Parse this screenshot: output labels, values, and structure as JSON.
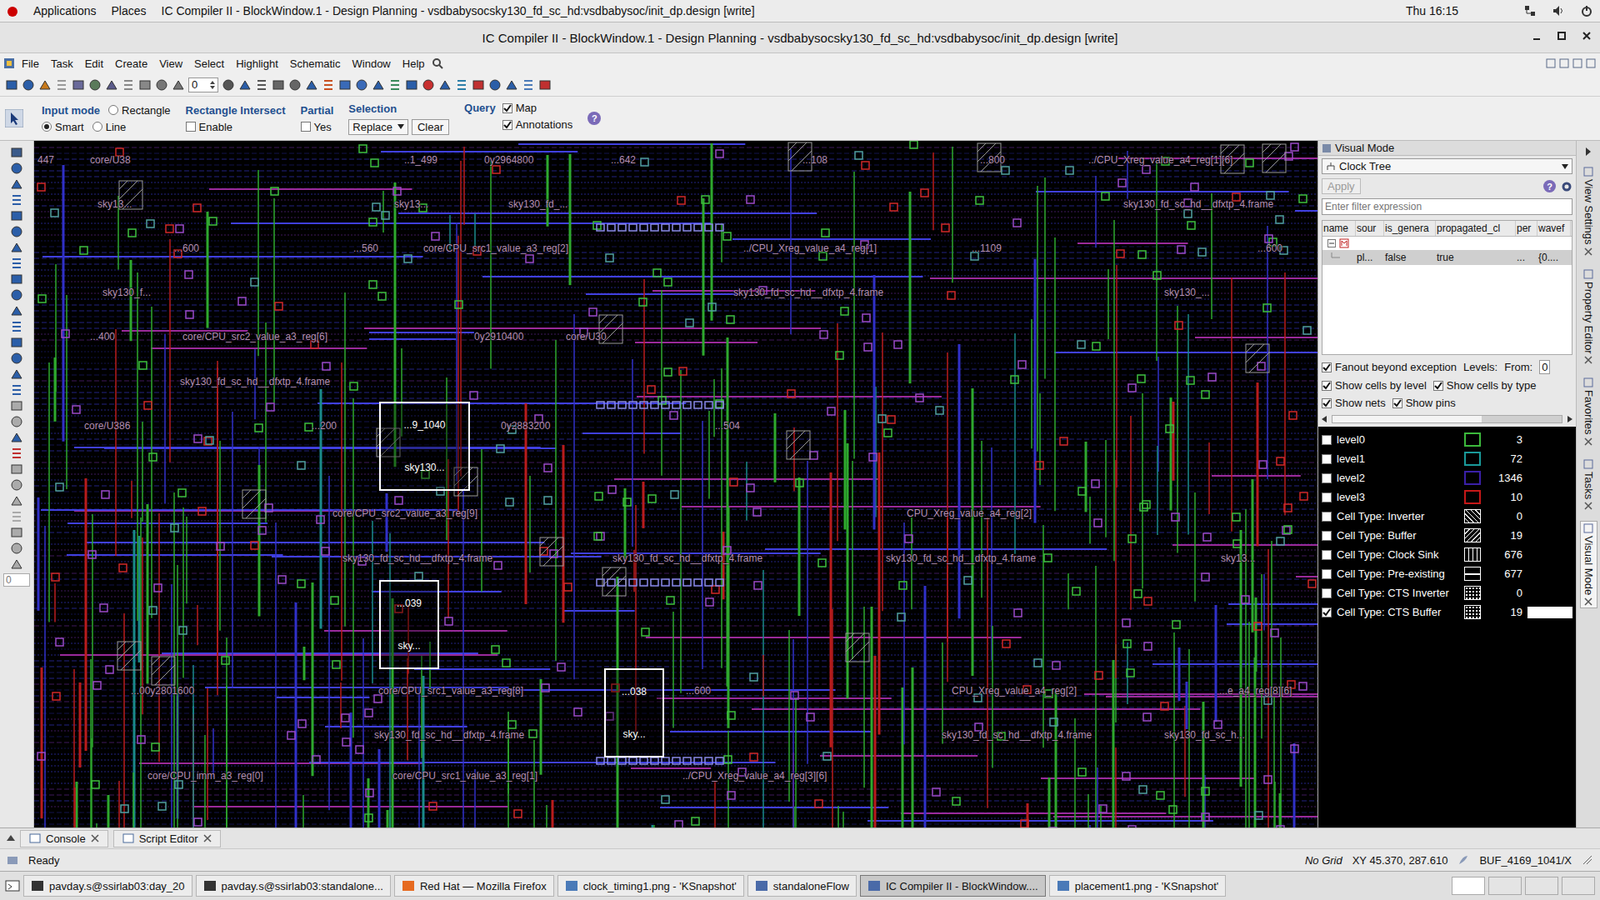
{
  "top_bar": {
    "apps": "Applications",
    "places": "Places",
    "title": "IC Compiler II - BlockWindow.1 - Design Planning - vsdbabysocsky130_fd_sc_hd:vsdbabysoc/init_dp.design [write]",
    "clock": "Thu 16:15"
  },
  "window": {
    "title": "IC Compiler II - BlockWindow.1 - Design Planning - vsdbabysocsky130_fd_sc_hd:vsdbabysoc/init_dp.design [write]"
  },
  "menu": [
    "File",
    "Task",
    "Edit",
    "Create",
    "View",
    "Select",
    "Highlight",
    "Schematic",
    "Window",
    "Help"
  ],
  "toolbar": {
    "spin_value": "0"
  },
  "options": {
    "input_mode": {
      "label": "Input mode",
      "options": [
        {
          "label": "Rectangle",
          "selected": false
        },
        {
          "label": "Smart",
          "selected": true
        },
        {
          "label": "Line",
          "selected": false
        }
      ]
    },
    "rect_intersect": {
      "label": "Rectangle Intersect",
      "option": {
        "label": "Enable",
        "checked": false
      }
    },
    "partial": {
      "label": "Partial",
      "option": {
        "label": "Yes",
        "checked": false
      }
    },
    "selection": {
      "label": "Selection",
      "value": "Replace",
      "clear": "Clear"
    },
    "query": {
      "label": "Query",
      "options": [
        {
          "label": "Map",
          "checked": true
        },
        {
          "label": "Annotations",
          "checked": true
        }
      ]
    },
    "help": "?"
  },
  "left_toolbar": {
    "field_value": "0"
  },
  "canvas": {
    "labels": [
      "447",
      "core/U38",
      "..1_499",
      "0y2964800",
      "...642",
      "...108",
      "...800",
      "../CPU_Xreg_value_a4_reg[1][6]",
      "sky13...",
      "sky13...",
      "sky130_fd_...",
      "sky130_fd_sc_hd__dfxtp_4.frame",
      "...600",
      "...560",
      "core/CPU_src1_value_a3_reg[2]",
      "../CPU_Xreg_value_a4_reg[1]",
      "...1109",
      "...600",
      "sky130_f...",
      "sky130_fd_sc_hd__dfxtp_4.frame",
      "sky130_...",
      "...400",
      "core/CPU_src2_value_a3_reg[6]",
      "0y2910400",
      "core/U30",
      "sky130_fd_sc_hd__dfxtp_4.frame",
      "0y2883200",
      "core/U386",
      "core/CPU_src2_value_a3_reg[9]",
      "CPU_Xreg_value_a4_reg[2]",
      "sky130_fd_sc_hd__dfxtp_4.frame",
      "sky130_fd_sc_hd__dfxtp_4.frame",
      "sky130_fd_sc_hd__dfxtp_4.frame",
      "sky13...",
      "...00y2801600",
      "core/CPU_src1_value_a3_reg[8]",
      "...600",
      "CPU_Xreg_value_a4_reg[2]",
      "...e_a4_reg[8][6]",
      "sky130_fd_sc_hd__dfxtp_4.frame",
      "sky130_fd_sc_hd__dfxtp_4.frame",
      "core/CPU_imm_a3_reg[0]",
      "core/CPU_src1_value_a3_reg[1]",
      "../CPU_Xreg_value_a4_reg[3][6]",
      "sky130_fd_sc_h...",
      "...200",
      "...504"
    ],
    "cts_buffers": [
      {
        "name": "...9_1040",
        "cell": "sky130..."
      },
      {
        "name": "...039",
        "cell": "sky..."
      },
      {
        "name": "...038",
        "cell": "sky..."
      }
    ]
  },
  "visual_mode": {
    "header": "Visual Mode",
    "mode": "Clock Tree",
    "apply": {
      "label": "Apply",
      "disabled": true
    },
    "help": "?",
    "filter_placeholder": "Enter filter expression",
    "columns": [
      "name",
      "sour",
      "is_genera",
      "propagated_cl",
      "per",
      "wavef"
    ],
    "tree_root": {
      "expanded": true
    },
    "rows": [
      {
        "cells": [
          "",
          "pl...",
          "false",
          "true",
          "...",
          "{0...."
        ],
        "selected": true
      }
    ],
    "options": [
      {
        "label": "Fanout beyond exception",
        "checked": true
      },
      {
        "label": "Show cells by level",
        "checked": true
      },
      {
        "label": "Show cells by type",
        "checked": true
      },
      {
        "label": "Show nets",
        "checked": true
      },
      {
        "label": "Show pins",
        "checked": true
      }
    ],
    "levels_label": "Levels:",
    "from_label": "From:",
    "from_value": "0",
    "legend": [
      {
        "label": "level0",
        "count": "3",
        "checked": false,
        "selected": false,
        "kind": "swatch",
        "color": "#3cb83c"
      },
      {
        "label": "level1",
        "count": "72",
        "checked": false,
        "selected": false,
        "kind": "swatch",
        "color": "#1a9a9a"
      },
      {
        "label": "level2",
        "count": "1346",
        "checked": false,
        "selected": false,
        "kind": "swatch",
        "color": "#3a20a8"
      },
      {
        "label": "level3",
        "count": "10",
        "checked": false,
        "selected": false,
        "kind": "swatch",
        "color": "#c41818"
      },
      {
        "label": "Cell Type: Inverter",
        "count": "0",
        "checked": false,
        "selected": false,
        "kind": "backslash"
      },
      {
        "label": "Cell Type: Buffer",
        "count": "19",
        "checked": false,
        "selected": false,
        "kind": "slash"
      },
      {
        "label": "Cell Type: Clock Sink",
        "count": "676",
        "checked": false,
        "selected": false,
        "kind": "vertical"
      },
      {
        "label": "Cell Type: Pre-existing",
        "count": "677",
        "checked": false,
        "selected": false,
        "kind": "horizontal"
      },
      {
        "label": "Cell Type: CTS Inverter",
        "count": "0",
        "checked": false,
        "selected": false,
        "kind": "dotted"
      },
      {
        "label": "Cell Type: CTS Buffer",
        "count": "19",
        "checked": true,
        "selected": true,
        "kind": "dotted"
      }
    ]
  },
  "side_tabs": [
    {
      "label": "View Settings",
      "selected": false
    },
    {
      "label": "Property Editor",
      "selected": false
    },
    {
      "label": "Favorites",
      "selected": false
    },
    {
      "label": "Tasks",
      "selected": false
    },
    {
      "label": "Visual Mode",
      "selected": true
    }
  ],
  "bottom_tabs": [
    {
      "label": "Console",
      "selected": false
    },
    {
      "label": "Script Editor",
      "selected": false
    }
  ],
  "status": {
    "text": "Ready",
    "grid": "No Grid",
    "xy": "XY 45.370, 287.610",
    "object": "BUF_4169_1041/X"
  },
  "taskbar": [
    {
      "label": "pavday.s@ssirlab03:day_20",
      "selected": false
    },
    {
      "label": "pavday.s@ssirlab03:standalone...",
      "selected": false
    },
    {
      "label": "Red Hat — Mozilla Firefox",
      "selected": false
    },
    {
      "label": "clock_timing1.png - 'KSnapshot'",
      "selected": false
    },
    {
      "label": "standaloneFlow",
      "selected": false
    },
    {
      "label": "IC Compiler II - BlockWindow....",
      "selected": true
    },
    {
      "label": "placement1.png - 'KSnapshot'",
      "selected": false
    }
  ]
}
